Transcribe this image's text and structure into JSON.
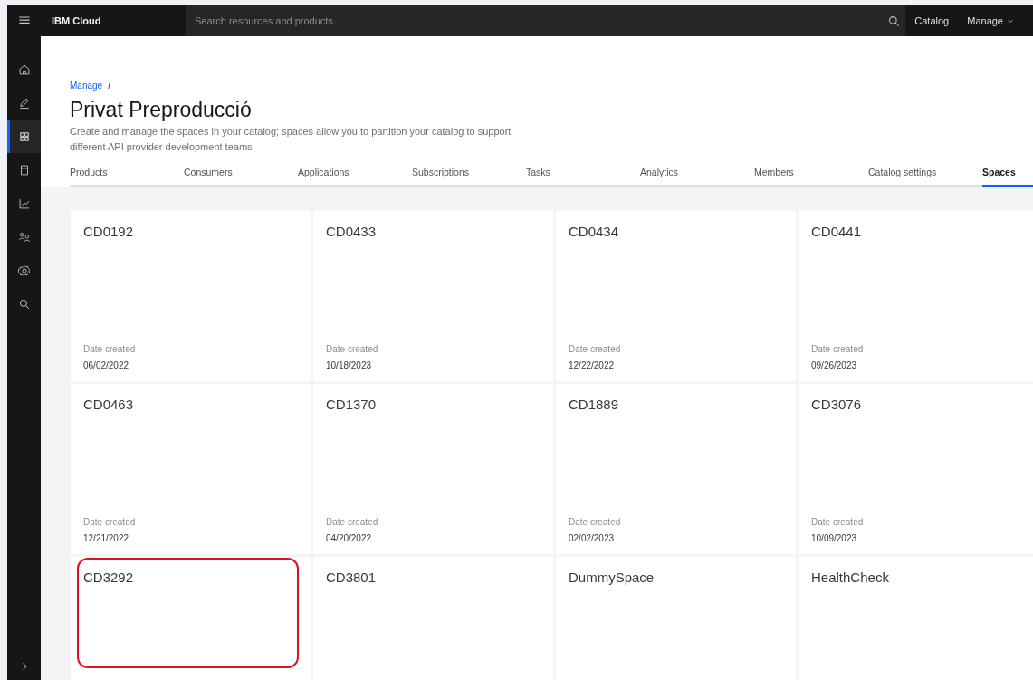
{
  "topbar": {
    "brand": "IBM Cloud",
    "search": {
      "placeholder": "Search resources and products..."
    },
    "links": [
      {
        "label": "Catalog",
        "kind": "link"
      },
      {
        "label": "Manage",
        "kind": "dropdown"
      }
    ]
  },
  "sidenav": {
    "items": [
      {
        "kind": "home",
        "selected": false
      },
      {
        "kind": "edit",
        "selected": false
      },
      {
        "kind": "grid",
        "selected": true
      },
      {
        "kind": "document",
        "selected": false
      },
      {
        "kind": "chart",
        "selected": false
      },
      {
        "kind": "users",
        "selected": false
      },
      {
        "kind": "settings",
        "selected": false
      },
      {
        "kind": "search",
        "selected": false
      }
    ]
  },
  "breadcrumb": [
    {
      "label": "Manage",
      "separator": "/"
    }
  ],
  "title": "Privat Preproducció",
  "description": "Create and manage the spaces in your catalog; spaces allow you to partition your catalog to support different API provider development teams",
  "tabs": [
    {
      "label": "Products",
      "selected": false
    },
    {
      "label": "Consumers",
      "selected": false
    },
    {
      "label": "Applications",
      "selected": false
    },
    {
      "label": "Subscriptions",
      "selected": false
    },
    {
      "label": "Tasks",
      "selected": false
    },
    {
      "label": "Analytics",
      "selected": false
    },
    {
      "label": "Members",
      "selected": false
    },
    {
      "label": "Catalog settings",
      "selected": false
    },
    {
      "label": "Spaces",
      "selected": true
    }
  ],
  "spaces": [
    {
      "name": "CD0192",
      "date_label": "Date created",
      "date": "06/02/2022",
      "highlighted": false
    },
    {
      "name": "CD0433",
      "date_label": "Date created",
      "date": "10/18/2023",
      "highlighted": false
    },
    {
      "name": "CD0434",
      "date_label": "Date created",
      "date": "12/22/2022",
      "highlighted": false
    },
    {
      "name": "CD0441",
      "date_label": "Date created",
      "date": "09/26/2023",
      "highlighted": false
    },
    {
      "name": "CD0463",
      "date_label": "Date created",
      "date": "12/21/2022",
      "highlighted": false
    },
    {
      "name": "CD1370",
      "date_label": "Date created",
      "date": "04/20/2022",
      "highlighted": false
    },
    {
      "name": "CD1889",
      "date_label": "Date created",
      "date": "02/02/2023",
      "highlighted": false
    },
    {
      "name": "CD3076",
      "date_label": "Date created",
      "date": "10/09/2023",
      "highlighted": false
    },
    {
      "name": "CD3292",
      "highlighted": true
    },
    {
      "name": "CD3801",
      "highlighted": false
    },
    {
      "name": "DummySpace",
      "highlighted": false
    },
    {
      "name": "HealthCheck",
      "highlighted": false
    }
  ]
}
